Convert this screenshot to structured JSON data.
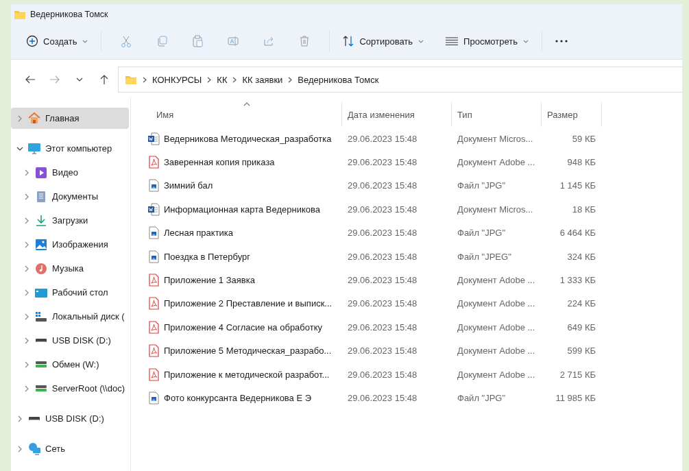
{
  "window": {
    "title": "Ведерникова Томск"
  },
  "toolbar": {
    "new_button": {
      "label": "Создать"
    },
    "icon_buttons": [
      {
        "kind": "cut",
        "disabled": true
      },
      {
        "kind": "copy",
        "disabled": true
      },
      {
        "kind": "paste",
        "disabled": true
      },
      {
        "kind": "rename",
        "disabled": true
      },
      {
        "kind": "share",
        "disabled": true
      },
      {
        "kind": "delete",
        "disabled": true
      }
    ],
    "sort_button": {
      "label": "Сортировать"
    },
    "view_button": {
      "label": "Просмотреть"
    }
  },
  "navigation": [
    {
      "kind": "back",
      "disabled": false
    },
    {
      "kind": "forward",
      "disabled": true
    },
    {
      "kind": "recent",
      "disabled": false
    },
    {
      "kind": "up",
      "disabled": false
    }
  ],
  "breadcrumbs": [
    "КОНКУРСЫ",
    "КК",
    "КК заявки",
    "Ведерникова Томск"
  ],
  "sidebar": {
    "items": [
      {
        "label": "Главная",
        "kind": "home",
        "selected": true,
        "expanded": false
      },
      {
        "label": "Этот компьютер",
        "kind": "computer",
        "selected": false,
        "expanded": true,
        "children": [
          {
            "label": "Видео",
            "kind": "video",
            "selected": false,
            "expanded": false
          },
          {
            "label": "Документы",
            "kind": "documents",
            "selected": false,
            "expanded": false
          },
          {
            "label": "Загрузки",
            "kind": "downloads",
            "selected": false,
            "expanded": false
          },
          {
            "label": "Изображения",
            "kind": "pictures",
            "selected": false,
            "expanded": false
          },
          {
            "label": "Музыка",
            "kind": "music",
            "selected": false,
            "expanded": false
          },
          {
            "label": "Рабочий стол",
            "kind": "desktop",
            "selected": false,
            "expanded": false
          },
          {
            "label": "Локальный диск (",
            "kind": "system-drive",
            "selected": false,
            "expanded": false
          },
          {
            "label": "USB DISK (D:)",
            "kind": "drive",
            "selected": false,
            "expanded": false
          },
          {
            "label": "Обмен (W:)",
            "kind": "network-drive",
            "selected": false,
            "expanded": false
          },
          {
            "label": "ServerRoot (\\\\doc)",
            "kind": "network-drive",
            "selected": false,
            "expanded": false
          }
        ]
      },
      {
        "label": "USB DISK (D:)",
        "kind": "drive",
        "selected": false,
        "expanded": false
      },
      {
        "label": "Сеть",
        "kind": "network",
        "selected": false,
        "expanded": false
      }
    ]
  },
  "table": {
    "columns": [
      {
        "label": "Имя",
        "sorted": true
      },
      {
        "label": "Дата изменения",
        "sorted": false
      },
      {
        "label": "Тип",
        "sorted": false
      },
      {
        "label": "Размер",
        "sorted": false
      }
    ],
    "rows": [
      {
        "name": "Ведерникова Методическая_разработка",
        "kind": "word",
        "date": "29.06.2023 15:48",
        "type": "Документ Micros...",
        "size": "59 КБ"
      },
      {
        "name": "Заверенная копия приказа",
        "kind": "pdf",
        "date": "29.06.2023 15:48",
        "type": "Документ Adobe ...",
        "size": "948 КБ"
      },
      {
        "name": "Зимний бал",
        "kind": "image",
        "date": "29.06.2023 15:48",
        "type": "Файл \"JPG\"",
        "size": "1 145 КБ"
      },
      {
        "name": "Информационная карта Ведерникова",
        "kind": "word",
        "date": "29.06.2023 15:48",
        "type": "Документ Micros...",
        "size": "18 КБ"
      },
      {
        "name": "Лесная практика",
        "kind": "image",
        "date": "29.06.2023 15:48",
        "type": "Файл \"JPG\"",
        "size": "6 464 КБ"
      },
      {
        "name": "Поездка в Петербург",
        "kind": "image",
        "date": "29.06.2023 15:48",
        "type": "Файл \"JPEG\"",
        "size": "324 КБ"
      },
      {
        "name": "Приложение 1 Заявка",
        "kind": "pdf",
        "date": "29.06.2023 15:48",
        "type": "Документ Adobe ...",
        "size": "1 333 КБ"
      },
      {
        "name": "Приложение 2 Преставление и выписк...",
        "kind": "pdf",
        "date": "29.06.2023 15:48",
        "type": "Документ Adobe ...",
        "size": "224 КБ"
      },
      {
        "name": "Приложение 4 Согласие на обработку",
        "kind": "pdf",
        "date": "29.06.2023 15:48",
        "type": "Документ Adobe ...",
        "size": "649 КБ"
      },
      {
        "name": "Приложение 5 Методическая_разрабо...",
        "kind": "pdf",
        "date": "29.06.2023 15:48",
        "type": "Документ Adobe ...",
        "size": "599 КБ"
      },
      {
        "name": "Приложение к методической разработ...",
        "kind": "pdf",
        "date": "29.06.2023 15:48",
        "type": "Документ Adobe ...",
        "size": "2 715 КБ"
      },
      {
        "name": "Фото конкурсанта Ведерникова Е Э",
        "kind": "image",
        "date": "29.06.2023 15:48",
        "type": "Файл \"JPG\"",
        "size": "11 985 КБ"
      }
    ]
  }
}
